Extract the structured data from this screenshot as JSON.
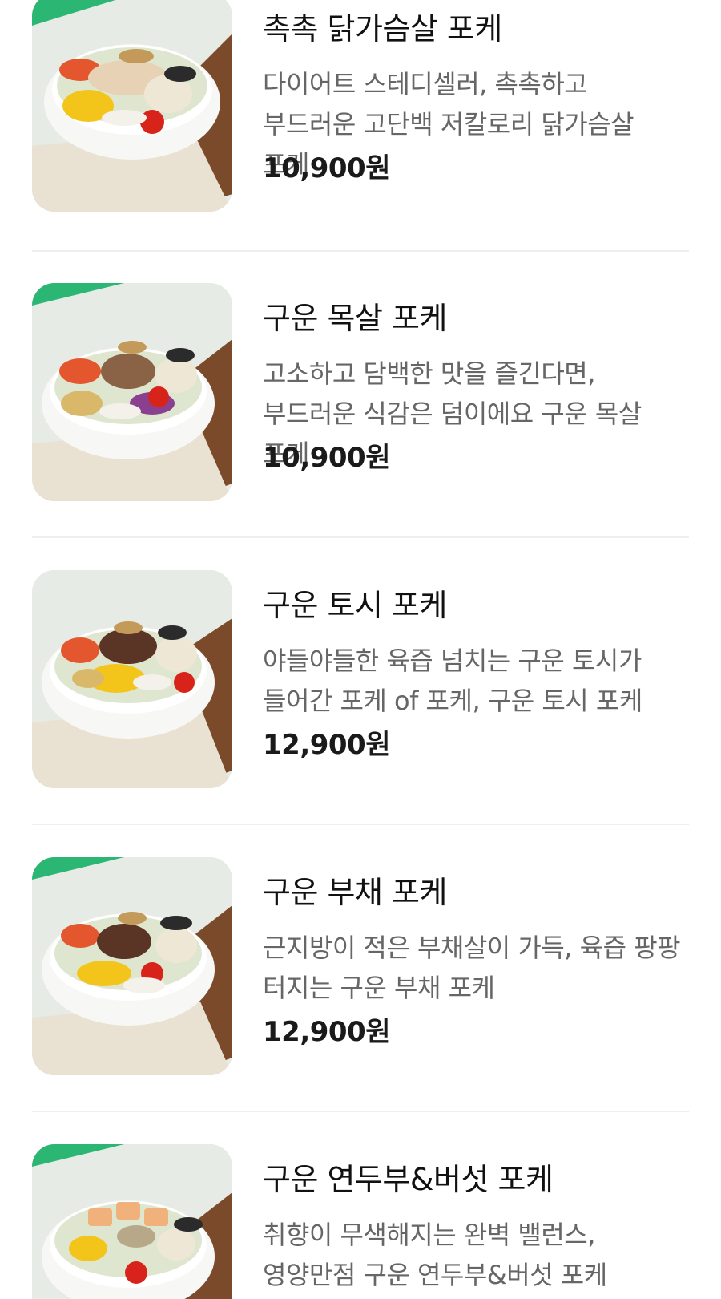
{
  "menu": {
    "items": [
      {
        "name": "촉촉 닭가슴살 포케",
        "description": "다이어트 스테디셀러, 촉촉하고 부드러운 고단백 저칼로리 닭가슴살 포케",
        "price": "10,900원",
        "image_icon": "chicken-breast-poke-photo"
      },
      {
        "name": "구운 목살 포케",
        "description": "고소하고 담백한 맛을 즐긴다면, 부드러운 식감은 덤이에요 구운 목살 포케",
        "price": "10,900원",
        "image_icon": "pork-neck-poke-photo"
      },
      {
        "name": "구운 토시 포케",
        "description": "야들야들한 육즙 넘치는 구운 토시가 들어간 포케 of 포케, 구운 토시 포케",
        "price": "12,900원",
        "image_icon": "hanger-steak-poke-photo"
      },
      {
        "name": "구운 부채 포케",
        "description": "근지방이 적은 부채살이 가득, 육즙 팡팡 터지는 구운 부채 포케",
        "price": "12,900원",
        "image_icon": "flat-iron-steak-poke-photo"
      },
      {
        "name": "구운 연두부&버섯 포케",
        "description": "취향이 무색해지는 완벽 밸런스, 영양만점 구운 연두부&버섯 포케",
        "price": "",
        "image_icon": "tofu-mushroom-poke-photo"
      }
    ]
  },
  "colors": {
    "brand_green": "#2bb673",
    "title_text": "#111111",
    "description_text": "#666666",
    "divider": "#eeeeee"
  }
}
